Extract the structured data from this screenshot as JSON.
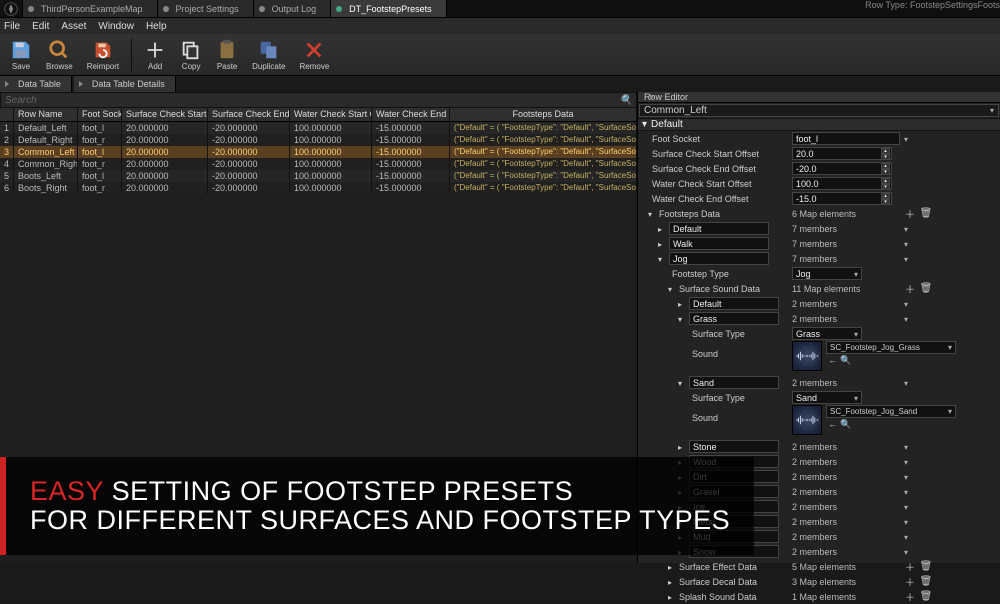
{
  "tabs": {
    "items": [
      "ThirdPersonExampleMap",
      "Project Settings",
      "Output Log",
      "DT_FootstepPresets"
    ],
    "active_index": 3
  },
  "row_type": "Row Type: FootstepSettingsFoots",
  "menu": [
    "File",
    "Edit",
    "Asset",
    "Window",
    "Help"
  ],
  "toolbar": [
    {
      "label": "Save",
      "icon": "save"
    },
    {
      "label": "Browse",
      "icon": "browse"
    },
    {
      "label": "Reimport",
      "icon": "reimport"
    },
    {
      "label": "SEP"
    },
    {
      "label": "Add",
      "icon": "add"
    },
    {
      "label": "Copy",
      "icon": "copy"
    },
    {
      "label": "Paste",
      "icon": "paste"
    },
    {
      "label": "Duplicate",
      "icon": "duplicate"
    },
    {
      "label": "Remove",
      "icon": "remove"
    }
  ],
  "sub_tabs": [
    "Data Table",
    "Data Table Details"
  ],
  "search_placeholder": "Search",
  "table": {
    "headers": [
      "",
      "Row Name",
      "Foot Socket",
      "Surface Check Start Offset",
      "Surface Check End Offset",
      "Water Check Start Offset",
      "Water Check End Offset",
      "Footsteps Data"
    ],
    "rows": [
      {
        "idx": "1",
        "name": "Default_Left",
        "sock": "foot_l",
        "sst": "20.000000",
        "sen": "-20.000000",
        "wst": "100.000000",
        "wen": "-15.000000",
        "data": "(\"Default\" = ( \"FootstepType\": \"Default\", \"SurfaceSoundData\": ( \"Default"
      },
      {
        "idx": "2",
        "name": "Default_Right",
        "sock": "foot_r",
        "sst": "20.000000",
        "sen": "-20.000000",
        "wst": "100.000000",
        "wen": "-15.000000",
        "data": "(\"Default\" = ( \"FootstepType\": \"Default\", \"SurfaceSoundData\": ( \"Default"
      },
      {
        "idx": "3",
        "name": "Common_Left",
        "sock": "foot_l",
        "sst": "20.000000",
        "sen": "-20.000000",
        "wst": "100.000000",
        "wen": "-15.000000",
        "data": "(\"Default\" = ( \"FootstepType\": \"Default\", \"SurfaceSoundData\": ( \"Default",
        "selected": true
      },
      {
        "idx": "4",
        "name": "Common_Right",
        "sock": "foot_r",
        "sst": "20.000000",
        "sen": "-20.000000",
        "wst": "100.000000",
        "wen": "-15.000000",
        "data": "(\"Default\" = ( \"FootstepType\": \"Default\", \"SurfaceSoundData\": ( \"Default"
      },
      {
        "idx": "5",
        "name": "Boots_Left",
        "sock": "foot_l",
        "sst": "20.000000",
        "sen": "-20.000000",
        "wst": "100.000000",
        "wen": "-15.000000",
        "data": "(\"Default\" = ( \"FootstepType\": \"Default\", \"SurfaceSoundData\": ( \"Default"
      },
      {
        "idx": "6",
        "name": "Boots_Right",
        "sock": "foot_r",
        "sst": "20.000000",
        "sen": "-20.000000",
        "wst": "100.000000",
        "wen": "-15.000000",
        "data": "(\"Default\" = ( \"FootstepType\": \"Default\", \"SurfaceSoundData\": ( \"Default"
      }
    ]
  },
  "row_editor": {
    "title": "Row Editor",
    "selected": "Common_Left",
    "section": "Default",
    "foot_socket_label": "Foot Socket",
    "foot_socket": "foot_l",
    "scso_label": "Surface Check Start Offset",
    "scso": "20.0",
    "sceo_label": "Surface Check End Offset",
    "sceo": "-20.0",
    "wcso_label": "Water Check Start Offset",
    "wcso": "100.0",
    "wceo_label": "Water Check End Offset",
    "wceo": "-15.0",
    "fsd_label": "Footsteps Data",
    "fsd_info": "6 Map elements",
    "fsd_default": "Default",
    "fsd_default_info": "7 members",
    "fsd_walk": "Walk",
    "fsd_walk_info": "7 members",
    "fsd_jog": "Jog",
    "fsd_jog_info": "7 members",
    "ft_label": "Footstep Type",
    "ft_value": "Jog",
    "ssd_label": "Surface Sound Data",
    "ssd_info": "11 Map elements",
    "ssd_default": "Default",
    "ssd_default_info": "2 members",
    "ssd_grass": "Grass",
    "ssd_grass_info": "2 members",
    "st_label": "Surface Type",
    "st_grass": "Grass",
    "sound_label": "Sound",
    "sound_grass": "SC_Footstep_Jog_Grass",
    "ssd_sand": "Sand",
    "ssd_sand_info": "2 members",
    "st_sand": "Sand",
    "sound_sand": "SC_Footstep_Jog_Sand",
    "extra": [
      {
        "name": "Stone",
        "info": "2 members"
      },
      {
        "name": "Wood",
        "info": "2 members"
      },
      {
        "name": "Dirt",
        "info": "2 members"
      },
      {
        "name": "Gravel",
        "info": "2 members"
      },
      {
        "name": "Ice",
        "info": "2 members"
      },
      {
        "name": "Metal",
        "info": "2 members"
      },
      {
        "name": "Mud",
        "info": "2 members"
      },
      {
        "name": "Snow",
        "info": "2 members"
      }
    ],
    "sed_label": "Surface Effect Data",
    "sed_info": "5 Map elements",
    "sdd_label": "Surface Decal Data",
    "sdd_info": "3 Map elements",
    "spd_label": "Splash Sound Data",
    "spd_info": "1 Map elements"
  },
  "overlay": {
    "line1_accent": "EASY",
    "line1_rest": " SETTING OF FOOTSTEP PRESETS",
    "line2": "FOR DIFFERENT SURFACES AND FOOTSTEP TYPES"
  }
}
